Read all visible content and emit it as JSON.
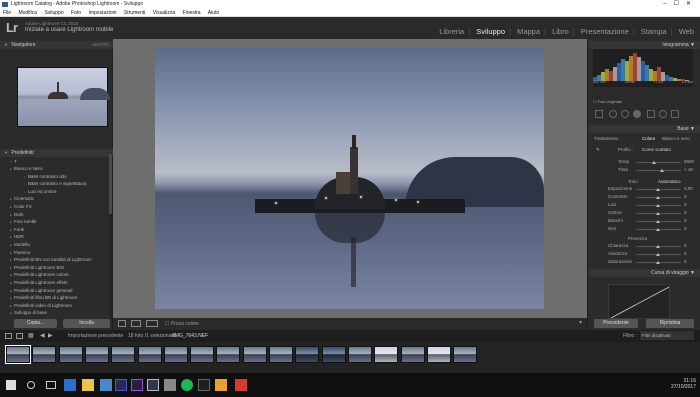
{
  "titlebar": {
    "title": "Lightroom Catalog - Adobe Photoshop Lightroom - Sviluppo"
  },
  "menu": [
    "File",
    "Modifica",
    "Sviluppo",
    "Foto",
    "Impostazioni",
    "Strumenti",
    "Visualizza",
    "Finestra",
    "Aiuto"
  ],
  "identity": {
    "logo": "Lr",
    "product": "Adobe Lightroom CC 2015",
    "tagline": "Iniziate a usare Lightroom mobile"
  },
  "modules": [
    {
      "label": "Libreria",
      "active": false
    },
    {
      "label": "Sviluppo",
      "active": true
    },
    {
      "label": "Mappa",
      "active": false
    },
    {
      "label": "Libro",
      "active": false
    },
    {
      "label": "Presentazione",
      "active": false
    },
    {
      "label": "Stampa",
      "active": false
    },
    {
      "label": "Web",
      "active": false
    }
  ],
  "navigator": {
    "title": "Navigatore",
    "mode": "ADATTA"
  },
  "presets": {
    "title": "Predefiniti",
    "items": [
      {
        "label": "Bianco e Nero",
        "icon": "folder-icon",
        "level": 1
      },
      {
        "label": "B&W contrasto alto",
        "icon": "preset-icon",
        "level": 2
      },
      {
        "label": "B&W contrasto e vignettatura",
        "icon": "preset-icon",
        "level": 2
      },
      {
        "label": "Luci ed ombre",
        "icon": "preset-icon",
        "level": 2
      },
      {
        "label": "Cinematic",
        "icon": "folder-icon",
        "level": 1
      },
      {
        "label": "Color FX",
        "icon": "folder-icon",
        "level": 1
      },
      {
        "label": "Dark",
        "icon": "folder-icon",
        "level": 1
      },
      {
        "label": "Foto tumblr",
        "icon": "folder-icon",
        "level": 1
      },
      {
        "label": "Funk",
        "icon": "folder-icon",
        "level": 1
      },
      {
        "label": "HDR",
        "icon": "folder-icon",
        "level": 1
      },
      {
        "label": "Modella",
        "icon": "folder-icon",
        "level": 1
      },
      {
        "label": "Paesino",
        "icon": "folder-icon",
        "level": 1
      },
      {
        "label": "Predefiniti BN con tonalità di Lightroom",
        "icon": "folder-icon",
        "level": 1
      },
      {
        "label": "Predefiniti Lightroom B/N",
        "icon": "folder-icon",
        "level": 1
      },
      {
        "label": "Predefiniti Lightroom colore",
        "icon": "folder-icon",
        "level": 1
      },
      {
        "label": "Predefiniti Lightroom effetti",
        "icon": "folder-icon",
        "level": 1
      },
      {
        "label": "Predefiniti Lightroom generali",
        "icon": "folder-icon",
        "level": 1
      },
      {
        "label": "Predefiniti filtro BN di Lightroom",
        "icon": "folder-icon",
        "level": 1
      },
      {
        "label": "Predefiniti video di Lightroom",
        "icon": "folder-icon",
        "level": 1
      },
      {
        "label": "Sviluppo di base",
        "icon": "folder-icon",
        "level": 1
      }
    ]
  },
  "left_buttons": {
    "copy": "Copia...",
    "paste": "Incolla"
  },
  "toolbar": {
    "soft_proof": "Prova colore"
  },
  "histogram": {
    "title": "Istogramma",
    "readout": [
      "ISO 100",
      "18 mm",
      "f / 3,5",
      "1/2 sec"
    ],
    "original_photo": "Foto originale"
  },
  "basic": {
    "title": "Base",
    "treatment_label": "Trattamento :",
    "treatment_options": [
      "Colore",
      "Bianco e nero"
    ],
    "profile_label": "Profilo :",
    "profile_value": "Come scattato",
    "temp_label": "Temp",
    "temp_value": "5650",
    "tint_label": "Tinta",
    "tint_value": "+ 18",
    "tone_label": "Tono",
    "tone_auto": "Automatico",
    "sliders": [
      {
        "label": "Esposizione",
        "value": "0,00"
      },
      {
        "label": "Contrasto",
        "value": "0"
      },
      {
        "label": "Luci",
        "value": "0"
      },
      {
        "label": "Ombre",
        "value": "0"
      },
      {
        "label": "Bianchi",
        "value": "0"
      },
      {
        "label": "Neri",
        "value": "0"
      }
    ],
    "presence_label": "Presenza",
    "presence_sliders": [
      {
        "label": "Chiarezza",
        "value": "0"
      },
      {
        "label": "Vividezza",
        "value": "0"
      },
      {
        "label": "Saturazione",
        "value": "0"
      }
    ]
  },
  "tone_curve": {
    "title": "Curva di viraggio"
  },
  "right_buttons": {
    "previous": "Precedente",
    "reset": "Ripristina"
  },
  "filmstrip_bar": {
    "source": "Importazione precedente",
    "count": "18 foto /1 selezionata",
    "filename": "/IMG_7643.NEF",
    "filter_label": "Filtro :",
    "filter_value": "Filtri disattivati"
  },
  "taskbar": {
    "time": "21:16",
    "date": "27/10/2017"
  },
  "colors": {
    "accent": "#e8e8e8",
    "panel_bg": "#2b2b2b",
    "center_bg": "#6e6e6e"
  }
}
